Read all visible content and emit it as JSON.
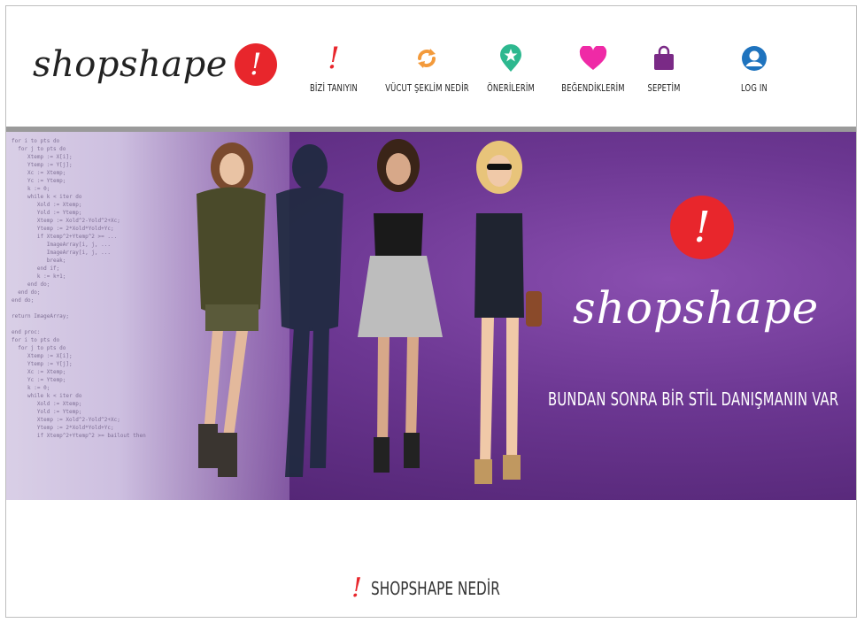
{
  "logo": {
    "text": "shopshape",
    "badge": "!"
  },
  "nav": {
    "items": [
      {
        "label": "BİZİ TANIYIN",
        "icon": "exclamation-icon",
        "color": "#e8262c"
      },
      {
        "label": "VÜCUT ŞEKLİM NEDİR",
        "icon": "refresh-icon",
        "color": "#f39a3b"
      },
      {
        "label": "ÖNERİLERİM",
        "icon": "star-pin-icon",
        "color": "#2db88f"
      },
      {
        "label": "BEĞENDİKLERİM",
        "icon": "heart-icon",
        "color": "#ef2aa6"
      },
      {
        "label": "SEPETİM",
        "icon": "shopping-bag-icon",
        "color": "#7a2a86"
      },
      {
        "label": "LOG IN",
        "icon": "user-icon",
        "color": "#1e73be"
      }
    ]
  },
  "hero": {
    "title": "shopshape",
    "badge": "!",
    "tagline": "BUNDAN SONRA BİR STİL DANIŞMANIN VAR"
  },
  "section": {
    "title": "SHOPSHAPE NEDİR",
    "mark": "!"
  },
  "colors": {
    "accent": "#e8262c",
    "hero_purple": "#6c3792"
  }
}
